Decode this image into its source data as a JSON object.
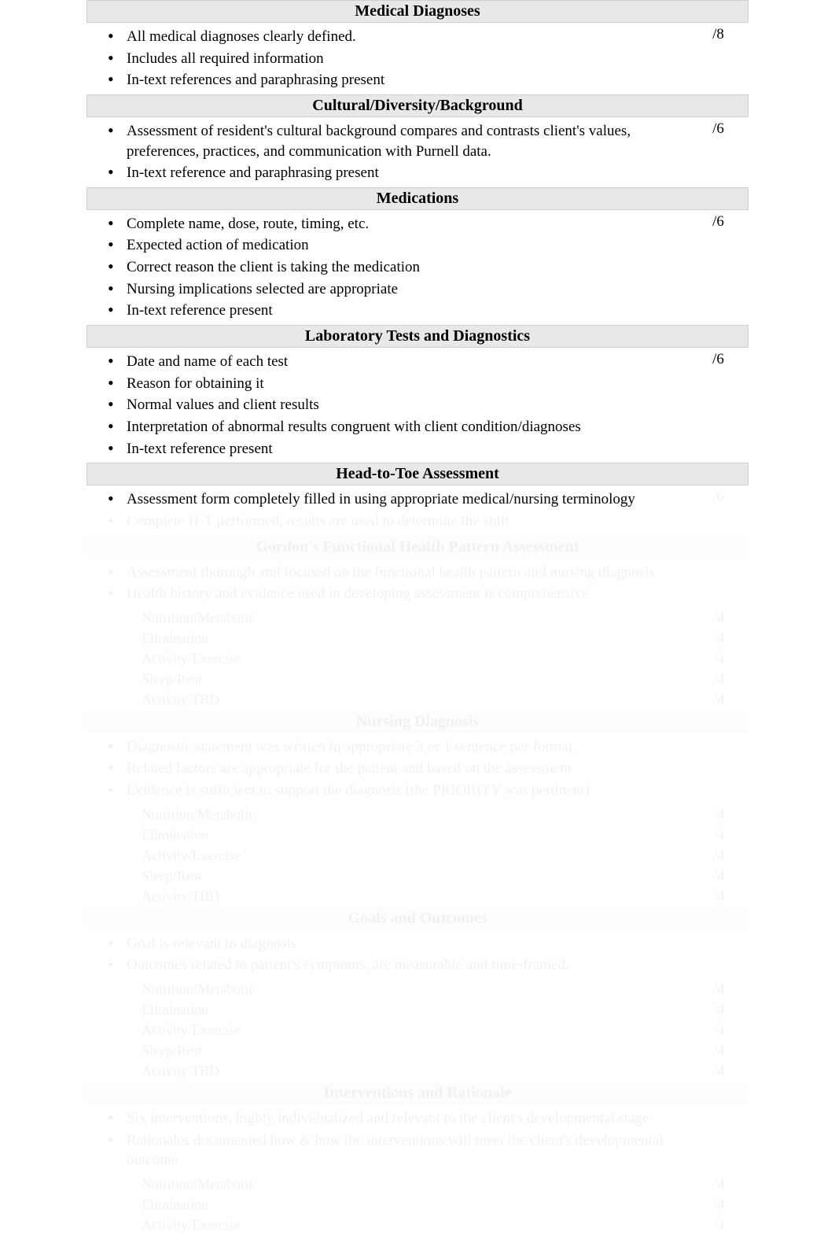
{
  "sections": [
    {
      "title": "Medical Diagnoses",
      "bullets": [
        "All medical diagnoses clearly defined.",
        "Includes all required information",
        "In-text references and paraphrasing present"
      ],
      "score": "/8"
    },
    {
      "title": "Cultural/Diversity/Background",
      "bullets": [
        "Assessment of resident's cultural background compares and contrasts client's values, preferences, practices, and communication with Purnell data.",
        "In-text reference and paraphrasing present"
      ],
      "score": "/6"
    },
    {
      "title": "Medications",
      "bullets": [
        "Complete name, dose, route, timing, etc.",
        "Expected action of medication",
        "Correct reason the client is taking the medication",
        "Nursing implications selected are appropriate",
        "In-text reference present"
      ],
      "score": "/6"
    },
    {
      "title": "Laboratory Tests and Diagnostics",
      "bullets": [
        "Date and name of each test",
        "Reason for obtaining it",
        "Normal values and client results",
        "Interpretation of abnormal results congruent with client condition/diagnoses",
        "In-text reference present"
      ],
      "score": "/6"
    },
    {
      "title": "Head-to-Toe Assessment",
      "bullets": [
        "Assessment form completely filled in using appropriate medical/nursing terminology",
        "Complete H-T performed, results are used to determine the shift"
      ],
      "score": "/6"
    }
  ],
  "faded_sections": [
    {
      "title": "Gordon's Functional Health Pattern Assessment",
      "bullets": [
        "Assessment thorough and focused on the functional health pattern and nursing diagnosis",
        "Health history and evidence used in developing assessment is comprehensive"
      ],
      "subs": [
        {
          "label": "Nutrition/Metabolic",
          "score": "/4"
        },
        {
          "label": "Elimination",
          "score": "/4"
        },
        {
          "label": "Activity/Exercise",
          "score": "/4"
        },
        {
          "label": "Sleep/Rest",
          "score": "/4"
        },
        {
          "label": "Activity TBD",
          "score": "/4"
        }
      ]
    },
    {
      "title": "Nursing Diagnosis",
      "bullets": [
        "Diagnostic statement was written in appropriate 3 or 1 sentence per format.",
        "Related factors are appropriate for the patient and based on the assessment",
        "Evidence is sufficient to support the diagnosis (the PRIORITY was pertinent)"
      ],
      "subs": [
        {
          "label": "Nutrition/Metabolic",
          "score": "/4"
        },
        {
          "label": "Elimination",
          "score": "/4"
        },
        {
          "label": "Activity/Exercise",
          "score": "/4"
        },
        {
          "label": "Sleep/Rest",
          "score": "/4"
        },
        {
          "label": "Activity TBD",
          "score": "/4"
        }
      ]
    },
    {
      "title": "Goals and Outcomes",
      "bullets": [
        "Goal is relevant to diagnosis",
        "Outcomes related to patient's symptoms, are measurable and time-framed."
      ],
      "subs": [
        {
          "label": "Nutrition/Metabolic",
          "score": "/4"
        },
        {
          "label": "Elimination",
          "score": "/4"
        },
        {
          "label": "Activity/Exercise",
          "score": "/4"
        },
        {
          "label": "Sleep/Rest",
          "score": "/4"
        },
        {
          "label": "Activity TBD",
          "score": "/4"
        }
      ]
    },
    {
      "title": "Interventions and Rationale",
      "bullets": [
        "Six interventions, highly individualized and relevant to the client's developmental stage",
        "Rationales documented how & how the interventions will meet the client's developmental outcome"
      ],
      "subs": [
        {
          "label": "Nutrition/Metabolic",
          "score": "/4"
        },
        {
          "label": "Elimination",
          "score": "/4"
        },
        {
          "label": "Activity/Exercise",
          "score": "/4"
        }
      ]
    }
  ]
}
